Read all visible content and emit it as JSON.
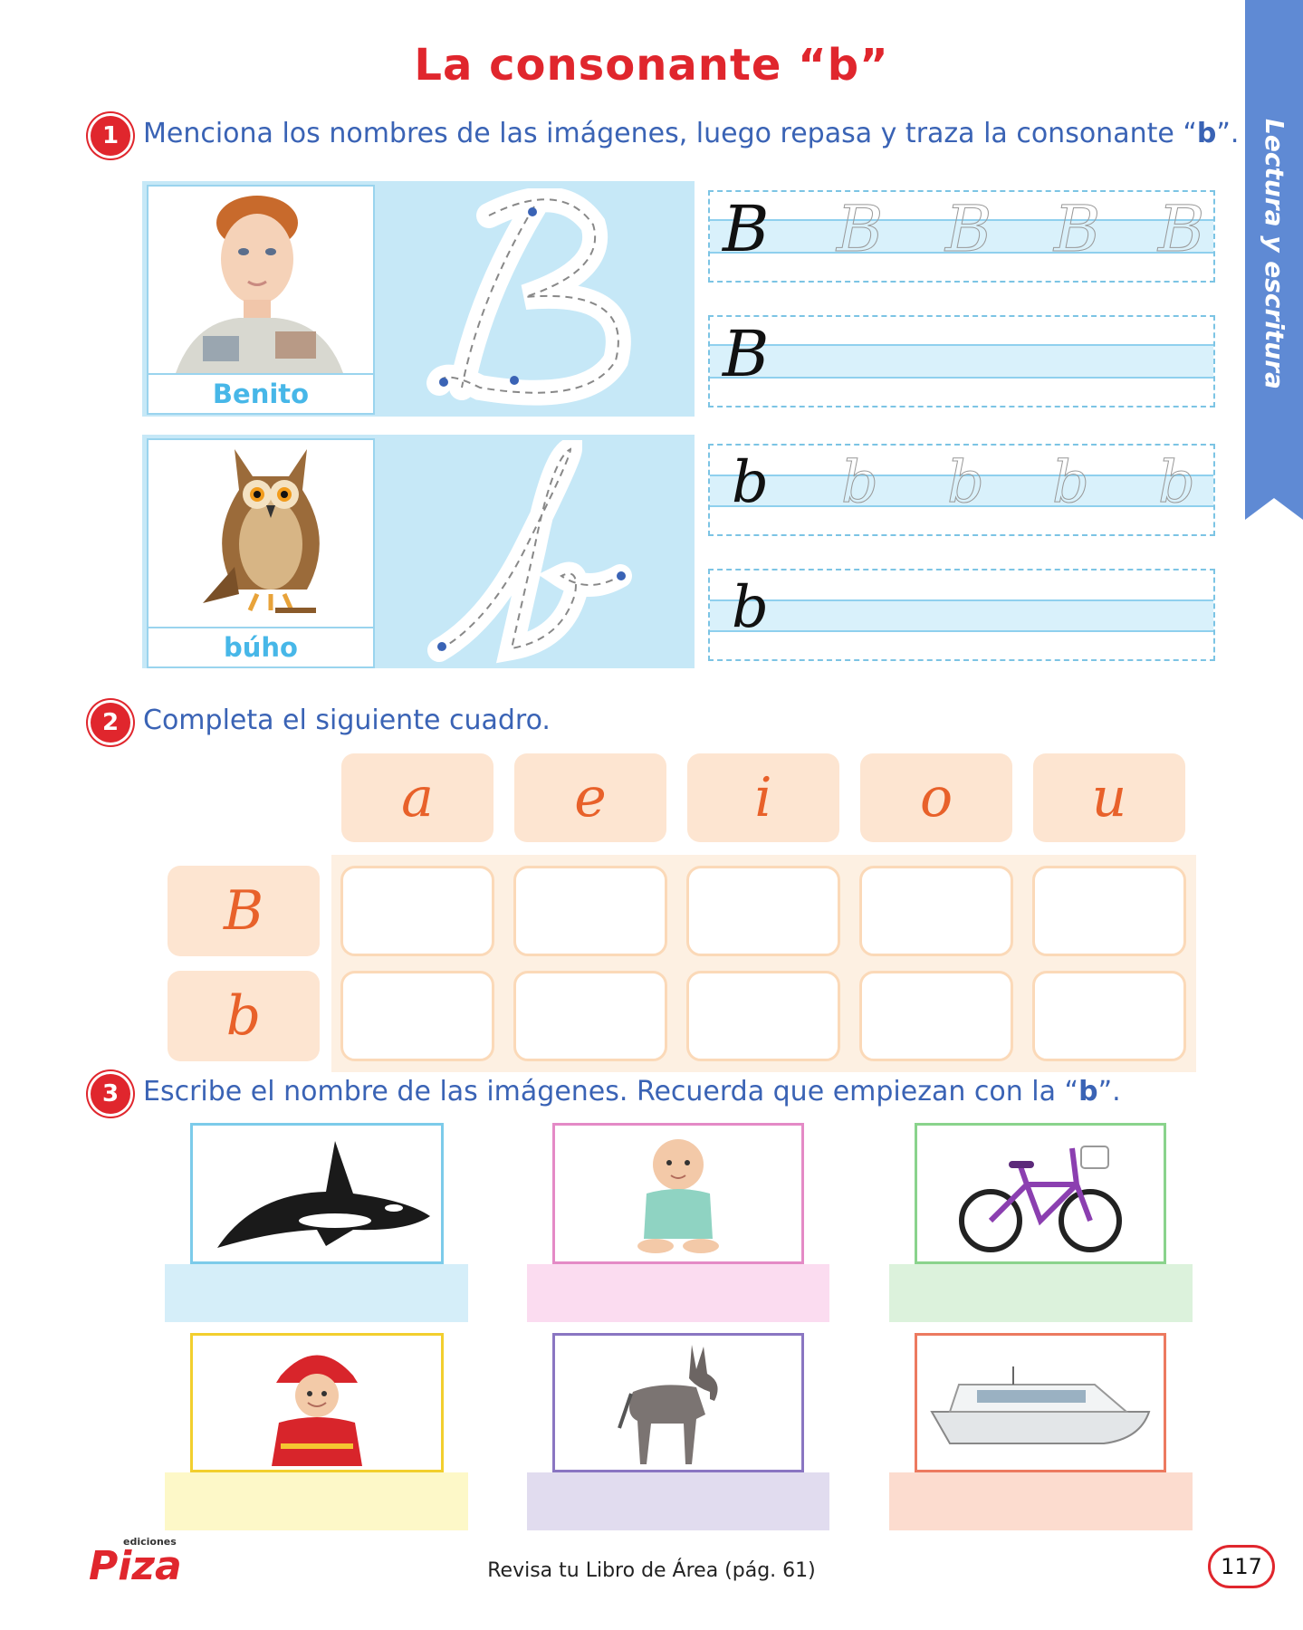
{
  "title": "La consonante “b”",
  "side_tab": "Lectura y escritura",
  "section1": {
    "number": "1",
    "instruction_pre": "Menciona los nombres de las imágenes, luego repasa y traza la consonante “",
    "instruction_letter": "b",
    "instruction_post": "”.",
    "upper": {
      "name": "Benito",
      "letter": "B"
    },
    "lower": {
      "name": "búho",
      "letter": "b"
    }
  },
  "section2": {
    "number": "2",
    "instruction": "Completa el siguiente cuadro.",
    "vowels": [
      "a",
      "e",
      "i",
      "o",
      "u"
    ],
    "rows": [
      "B",
      "b"
    ]
  },
  "section3": {
    "number": "3",
    "instruction_pre": "Escribe el nombre de las imágenes. Recuerda que empiezan con la “",
    "instruction_letter": "b",
    "instruction_post": "”.",
    "items": [
      {
        "icon": "orca-icon",
        "border": "#7ccbea",
        "fill": "#d5eef9"
      },
      {
        "icon": "baby-icon",
        "border": "#e48ac6",
        "fill": "#fbdcf0"
      },
      {
        "icon": "bicycle-icon",
        "border": "#8ad38c",
        "fill": "#dcf2dc"
      },
      {
        "icon": "firefighter-icon",
        "border": "#f2cf2e",
        "fill": "#fdf8c8"
      },
      {
        "icon": "donkey-icon",
        "border": "#8a76c2",
        "fill": "#e1dcef"
      },
      {
        "icon": "boat-icon",
        "border": "#ec7a60",
        "fill": "#fcdccf"
      }
    ]
  },
  "footer": {
    "logo": "Piza",
    "logo_small": "ediciones",
    "text": "Revisa tu Libro de Área (pág. 61)",
    "page": "117"
  }
}
